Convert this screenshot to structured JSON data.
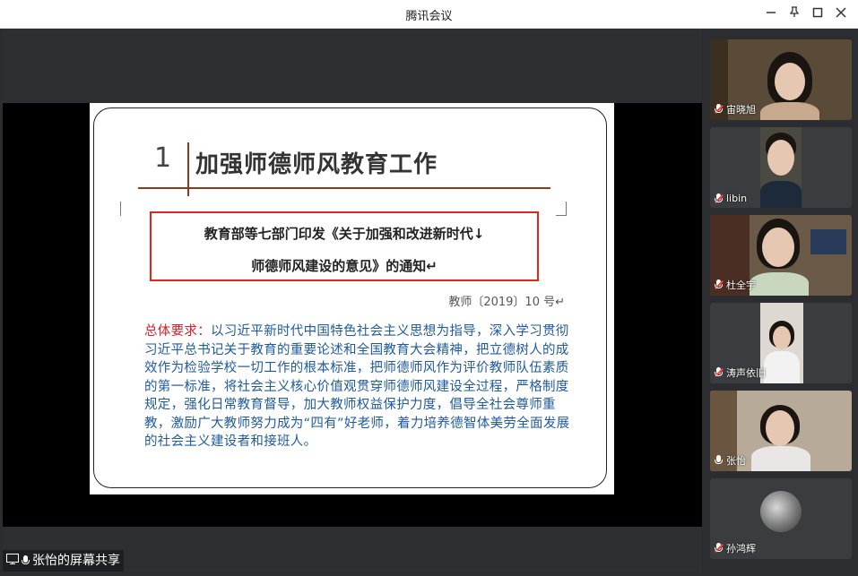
{
  "window": {
    "title": "腾讯会议"
  },
  "slide": {
    "number": "1",
    "title": "加强师德师风教育工作",
    "notice_line1": "教育部等七部门印发《关于加强和改进新时代↓",
    "notice_line2": "师德师风建设的意见》的通知↵",
    "doc_number": "教师〔2019〕10 号↵",
    "requirements_label": "总体要求：",
    "requirements_text": "以习近平新时代中国特色社会主义思想为指导，深入学习贯彻习近平总书记关于教育的重要论述和全国教育大会精神，把立德树人的成效作为检验学校一切工作的根本标准，把师德师风作为评价教师队伍素质的第一标准，将社会主义核心价值观贯穿师德师风建设全过程，严格制度规定，强化日常教育督导，加大教师权益保护力度，倡导全社会尊师重教，激励广大教师努力成为“四有”好老师，着力培养德智体美劳全面发展的社会主义建设者和接班人。"
  },
  "share_banner": {
    "text": "张怡的屏幕共享"
  },
  "participants": [
    {
      "name": "宙晓旭",
      "muted": true
    },
    {
      "name": "libin",
      "muted": true
    },
    {
      "name": "杜全宇",
      "muted": true
    },
    {
      "name": "涛声依旧",
      "muted": true
    },
    {
      "name": "张怡",
      "muted": false
    },
    {
      "name": "孙鸿辉",
      "muted": true
    }
  ],
  "colors": {
    "accent_red": "#e2241d",
    "text_blue": "#1f5a9e",
    "label_red": "#d2222a"
  },
  "icons": {
    "minimize": "minimize-icon",
    "maximize": "maximize-icon",
    "close": "close-icon",
    "pin": "pin-icon",
    "mic": "microphone-icon"
  }
}
